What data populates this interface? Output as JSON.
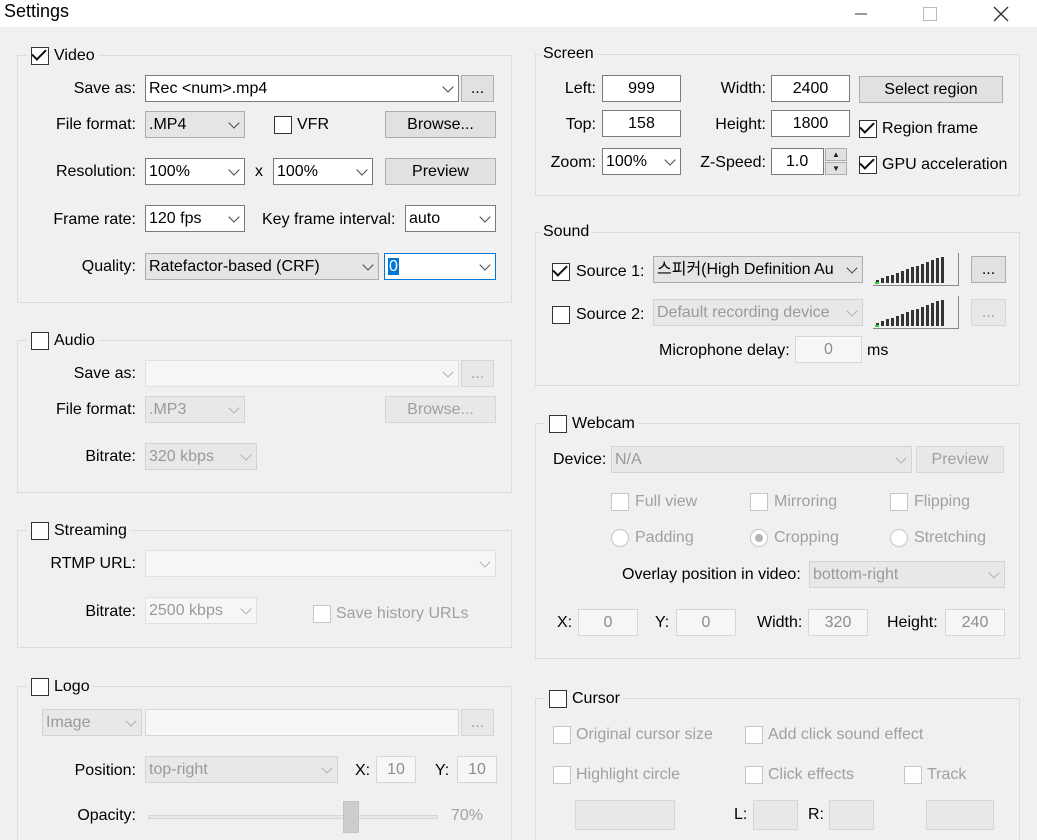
{
  "window": {
    "title": "Settings"
  },
  "video": {
    "title": "Video",
    "enabled": true,
    "save_as_label": "Save as:",
    "save_as_value": "Rec <num>.mp4",
    "browse_dots": "...",
    "file_format_label": "File format:",
    "file_format_value": ".MP4",
    "vfr_label": "VFR",
    "browse_label": "Browse...",
    "resolution_label": "Resolution:",
    "res_w": "100%",
    "res_x": "x",
    "res_h": "100%",
    "preview_label": "Preview",
    "frame_rate_label": "Frame rate:",
    "frame_rate_value": "120 fps",
    "keyframe_label": "Key frame interval:",
    "keyframe_value": "auto",
    "quality_label": "Quality:",
    "quality_mode": "Ratefactor-based (CRF)",
    "quality_value": "0"
  },
  "audio": {
    "title": "Audio",
    "enabled": false,
    "save_as_label": "Save as:",
    "save_as_value": "",
    "browse_dots": "...",
    "file_format_label": "File format:",
    "file_format_value": ".MP3",
    "browse_label": "Browse...",
    "bitrate_label": "Bitrate:",
    "bitrate_value": "320 kbps"
  },
  "streaming": {
    "title": "Streaming",
    "enabled": false,
    "rtmp_label": "RTMP URL:",
    "rtmp_value": "",
    "bitrate_label": "Bitrate:",
    "bitrate_value": "2500 kbps",
    "save_history_label": "Save history URLs"
  },
  "logo": {
    "title": "Logo",
    "enabled": false,
    "type_value": "Image",
    "path_value": "",
    "browse_dots": "...",
    "position_label": "Position:",
    "position_value": "top-right",
    "x_label": "X:",
    "x_value": "10",
    "y_label": "Y:",
    "y_value": "10",
    "opacity_label": "Opacity:",
    "opacity_value": "70%",
    "opacity": 0.7
  },
  "screen": {
    "title": "Screen",
    "left_label": "Left:",
    "left_value": "999",
    "top_label": "Top:",
    "top_value": "158",
    "zoom_label": "Zoom:",
    "zoom_value": "100%",
    "width_label": "Width:",
    "width_value": "2400",
    "height_label": "Height:",
    "height_value": "1800",
    "zspeed_label": "Z-Speed:",
    "zspeed_value": "1.0",
    "select_region_label": "Select region",
    "region_frame_label": "Region frame",
    "region_frame": true,
    "gpu_label": "GPU acceleration",
    "gpu": true
  },
  "sound": {
    "title": "Sound",
    "source1_label": "Source 1:",
    "source1_value": "스피커(High Definition Au",
    "source1_enabled": true,
    "source2_label": "Source 2:",
    "source2_value": "Default recording device",
    "source2_enabled": false,
    "more": "...",
    "mic_delay_label": "Microphone delay:",
    "mic_delay_value": "0",
    "mic_delay_unit": "ms"
  },
  "webcam": {
    "title": "Webcam",
    "enabled": false,
    "device_label": "Device:",
    "device_value": "N/A",
    "preview_label": "Preview",
    "full_view": "Full view",
    "mirroring": "Mirroring",
    "flipping": "Flipping",
    "padding": "Padding",
    "cropping": "Cropping",
    "stretching": "Stretching",
    "overlay_label": "Overlay position in video:",
    "overlay_value": "bottom-right",
    "x_label": "X:",
    "x_value": "0",
    "y_label": "Y:",
    "y_value": "0",
    "width_label": "Width:",
    "width_value": "320",
    "height_label": "Height:",
    "height_value": "240"
  },
  "cursor": {
    "title": "Cursor",
    "enabled": false,
    "original_size": "Original cursor size",
    "click_sound": "Add click sound effect",
    "highlight": "Highlight circle",
    "click_effects": "Click effects",
    "track": "Track",
    "l_label": "L:",
    "r_label": "R:"
  },
  "colors": {
    "focus": "#0078d7",
    "window_bg": "#f0f0f0",
    "group_border": "#dcdcdc",
    "disabled_text": "#a0a0a0"
  }
}
